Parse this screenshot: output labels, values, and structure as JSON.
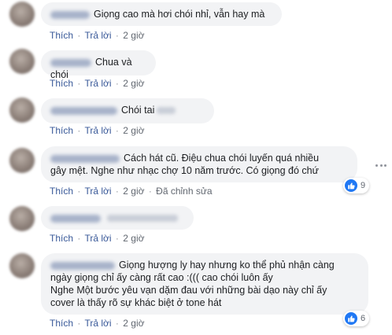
{
  "actions": {
    "like": "Thích",
    "reply": "Trả lời",
    "separator": "·",
    "edited": "Đã chỉnh sửa"
  },
  "comments": [
    {
      "text": "Giọng cao mà hơi chói nhỉ, vẫn hay mà",
      "time": "2 giờ"
    },
    {
      "text": "Chua và chói",
      "time": "2 giờ"
    },
    {
      "text": "Chói tai",
      "time": "2 giờ"
    },
    {
      "text_line1": "Cách hát cũ. Điệu chua chói luyến quá nhiều",
      "text_line2": "gây mệt. Nghe như nhạc chợ 10 năm trước. Có giọng đó chứ",
      "time": "2 giờ",
      "reactions": "9"
    },
    {
      "text": "",
      "time": "2 giờ"
    },
    {
      "text_line1": "Giọng hượng ly hay nhưng ko thể phủ nhận càng",
      "text_line2": "ngày giọng chỉ ấy càng rất cao :((( cao chói luôn ấy",
      "text_line3": "Nghe Một bước yêu vạn dặm đau với những bài dạo này chỉ ấy",
      "text_line4": "cover là thấy rõ sự khác biệt ở tone hát",
      "time": "2 giờ",
      "reactions": "6"
    }
  ]
}
